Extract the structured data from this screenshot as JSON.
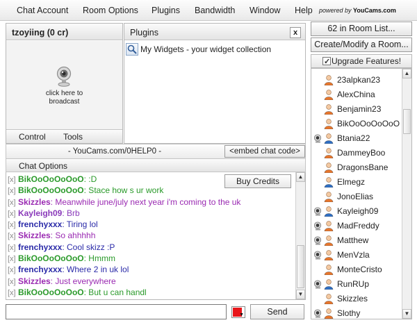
{
  "menu": {
    "items": [
      "Chat Account",
      "Room Options",
      "Plugins",
      "Bandwidth",
      "Window",
      "Help"
    ],
    "powered_by": "powered by",
    "brand": "YouCams.com"
  },
  "broadcast": {
    "user_title": "tzoyiing (0 cr)",
    "click_text": "click here to broadcast",
    "tabs": [
      "Control",
      "Tools"
    ]
  },
  "plugins": {
    "title": "Plugins",
    "close": "x",
    "widget_label": "My Widgets - your widget collection"
  },
  "urlbar": {
    "url": "- YouCams.com/0HELP0 -",
    "embed_label": "<embed chat code>"
  },
  "chat": {
    "header": "Chat Options",
    "buy_credits": "Buy Credits",
    "x_mark": "[x]",
    "messages": [
      {
        "nick": "BikOoOoOoOoO",
        "text": ": :D",
        "color": "#2a9a2a"
      },
      {
        "nick": "BikOoOoOoOoO",
        "text": ": Stace how s ur work",
        "color": "#2a9a2a"
      },
      {
        "nick": "Skizzles",
        "text": ": Meanwhile june/july next year i'm coming to the uk",
        "color": "#9a2ab2"
      },
      {
        "nick": "Kayleigh09",
        "text": ": Brb",
        "color": "#8a3aba"
      },
      {
        "nick": "frenchyxxx",
        "text": ": Tiring lol",
        "color": "#2a2aa8"
      },
      {
        "nick": "Skizzles",
        "text": ": So ahhhhh",
        "color": "#9a2ab2"
      },
      {
        "nick": "frenchyxxx",
        "text": ": Cool skizz :P",
        "color": "#2a2aa8"
      },
      {
        "nick": "BikOoOoOoOoO",
        "text": ": Hmmm",
        "color": "#2a9a2a"
      },
      {
        "nick": "frenchyxxx",
        "text": ": Where 2 in uk lol",
        "color": "#2a2aa8"
      },
      {
        "nick": "Skizzles",
        "text": ": Just everywhere",
        "color": "#9a2ab2"
      },
      {
        "nick": "BikOoOoOoOoO",
        "text": ": But u can handl",
        "color": "#2a9a2a"
      }
    ],
    "input_value": "",
    "text_color": "#e8161a",
    "send_label": "Send"
  },
  "right": {
    "room_list_label": "62 in Room List...",
    "create_room_label": "Create/Modify a Room...",
    "upgrade_label": "Upgrade Features!",
    "users": [
      {
        "name": "23alpkan23",
        "gender": "male",
        "cam": false
      },
      {
        "name": "AlexChina",
        "gender": "male",
        "cam": false
      },
      {
        "name": "Benjamin23",
        "gender": "male",
        "cam": false
      },
      {
        "name": "BikOoOoOoOoO",
        "gender": "male",
        "cam": false
      },
      {
        "name": "Btania22",
        "gender": "female",
        "cam": true
      },
      {
        "name": "DammeyBoo",
        "gender": "male",
        "cam": false
      },
      {
        "name": "DragonsBane",
        "gender": "male",
        "cam": false
      },
      {
        "name": "Elmegz",
        "gender": "female",
        "cam": false
      },
      {
        "name": "JonoElias",
        "gender": "male",
        "cam": false
      },
      {
        "name": "Kayleigh09",
        "gender": "female",
        "cam": true
      },
      {
        "name": "MadFreddy",
        "gender": "male",
        "cam": true
      },
      {
        "name": "Matthew",
        "gender": "male",
        "cam": true
      },
      {
        "name": "MenVzla",
        "gender": "male",
        "cam": true
      },
      {
        "name": "MonteCristo",
        "gender": "male",
        "cam": false
      },
      {
        "name": "RunRUp",
        "gender": "female",
        "cam": true
      },
      {
        "name": "Skizzles",
        "gender": "male",
        "cam": false
      },
      {
        "name": "Slothy",
        "gender": "male",
        "cam": true
      }
    ]
  },
  "icons": {
    "webcam": "webcam-icon",
    "magnifier": "magnifier-icon",
    "male_user": "male-user-icon",
    "female_user": "female-user-icon",
    "user_cam": "user-cam-icon"
  },
  "colors": {
    "male": "#e8762c",
    "female": "#2f6fc4"
  }
}
